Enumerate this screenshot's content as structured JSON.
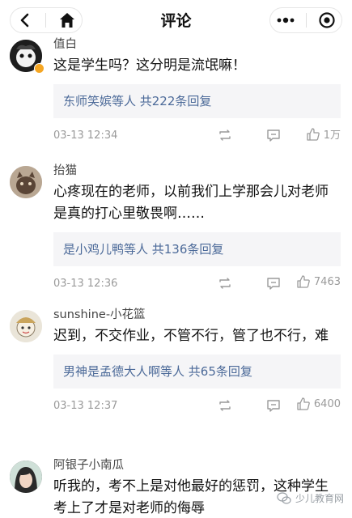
{
  "nav": {
    "title": "评论",
    "back_icon": "chevron-left-icon",
    "home_icon": "home-icon",
    "more_icon": "more-dots-icon",
    "target_icon": "target-icon"
  },
  "comments": [
    {
      "user": "值白",
      "text": "这是学生吗？这分明是流氓嘛！",
      "reply": "东师笑嫔等人 共222条回复",
      "time": "03-13 12:34",
      "likes": "1万"
    },
    {
      "user": "抬猫",
      "text": "心疼现在的老师，以前我们上学那会儿对老师是真的打心里敬畏啊……",
      "reply": "是小鸡儿鸭等人 共136条回复",
      "time": "03-13 12:36",
      "likes": "7463"
    },
    {
      "user": "sunshine-小花篮",
      "text": "迟到，不交作业，不管不行，管了也不行，难",
      "reply": "男神是孟德大人啊等人 共65条回复",
      "time": "03-13 12:37",
      "likes": "6400"
    },
    {
      "user": "阿银子小南瓜",
      "text": "听我的，考不上是对他最好的惩罚，这种学生考上了才是对老师的侮辱"
    }
  ],
  "watermark": {
    "text": "少儿教育网"
  },
  "colors": {
    "reply_link": "#4c6a99",
    "reply_bg": "#f5f5f7",
    "meta": "#9a9a9a"
  }
}
